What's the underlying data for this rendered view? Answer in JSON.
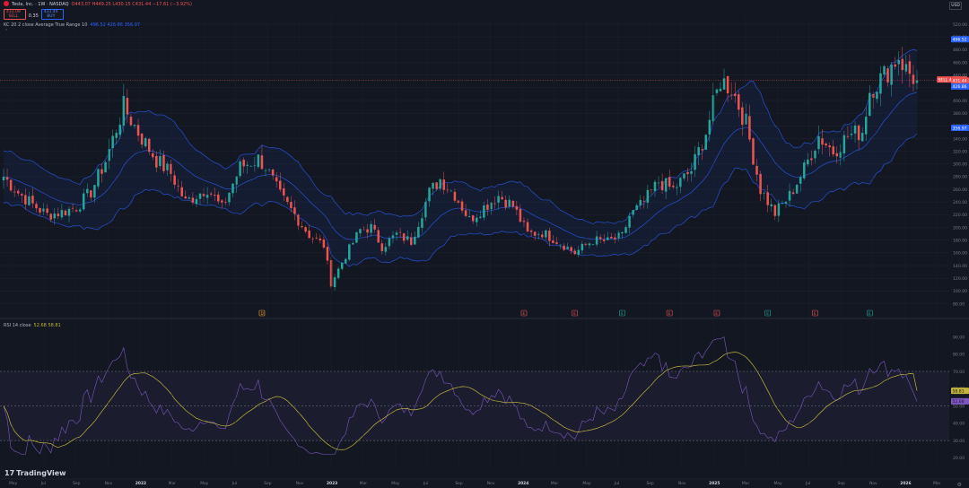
{
  "header": {
    "symbol": "Tesla, Inc. · 1W · NASDAQ",
    "ohlc": "O443.07 H449.25 L430.15 C431.44 −17.61 (−3.92%)",
    "sell_price": "431.09",
    "sell_label": "SELL",
    "spread": "0.35",
    "buy_price": "431.44",
    "buy_label": "BUY",
    "kc_label": "KC 20 2 close Average True Range 10",
    "kc_values": "496.52  426.86  356.97",
    "collapse": "⌃",
    "rsi_label": "RSI 14 close",
    "rsi_values": "52.68  58.81"
  },
  "currency": "USD",
  "brand": "TradingView",
  "settings_icon": "gear-icon",
  "colors": {
    "background": "#131722",
    "up": "#26a69a",
    "down": "#ef5350",
    "band": "#2962ff",
    "rsi": "#7e57c2",
    "rsi_ma": "#c2b43a",
    "grid": "#1e222d",
    "text": "#b2b5be"
  },
  "chart_data": [
    {
      "type": "candlestick",
      "title": "Tesla, Inc. · 1W · NASDAQ",
      "y_ticks": [
        80,
        100,
        120,
        140,
        160,
        180,
        200,
        220,
        240,
        260,
        280,
        300,
        320,
        340,
        360,
        380,
        400,
        420,
        440,
        460,
        480,
        500,
        520
      ],
      "ylim": [
        75,
        530
      ],
      "x_labels": [
        "May",
        "Jul",
        "Sep",
        "Nov",
        "2022",
        "Mar",
        "May",
        "Jul",
        "Sep",
        "Nov",
        "2023",
        "Mar",
        "May",
        "Jul",
        "Sep",
        "Nov",
        "2024",
        "Mar",
        "May",
        "Jul",
        "Sep",
        "Nov",
        "2025",
        "Mar",
        "May",
        "Jul",
        "Sep",
        "Nov",
        "2026",
        "Mar"
      ],
      "weeks": 252,
      "anchors_week": [
        0,
        4,
        8,
        12,
        16,
        20,
        24,
        28,
        33,
        37,
        42,
        46,
        50,
        56,
        60,
        65,
        70,
        72,
        76,
        80,
        84,
        88,
        90,
        94,
        98,
        101,
        104,
        108,
        112,
        117,
        120,
        124,
        128,
        132,
        136,
        140,
        144,
        148,
        153,
        157,
        162,
        166,
        170,
        172,
        176,
        180,
        184,
        189,
        193,
        197,
        200,
        204,
        208,
        212,
        216,
        220,
        224,
        228,
        232,
        236,
        238,
        242,
        246,
        248,
        251
      ],
      "anchors_close": [
        280,
        255,
        236,
        220,
        224,
        232,
        256,
        305,
        390,
        350,
        306,
        285,
        240,
        262,
        230,
        295,
        308,
        296,
        250,
        220,
        188,
        172,
        112,
        156,
        196,
        200,
        170,
        189,
        178,
        255,
        276,
        252,
        212,
        232,
        250,
        234,
        190,
        192,
        176,
        160,
        180,
        178,
        186,
        218,
        240,
        272,
        260,
        290,
        350,
        432,
        420,
        364,
        260,
        222,
        250,
        292,
        344,
        320,
        344,
        352,
        416,
        440,
        470,
        448,
        431
      ],
      "last_close": 431.44,
      "series": [
        {
          "name": "Price",
          "color": "#26a69a"
        },
        {
          "name": "KC upper",
          "color": "#2962ff"
        },
        {
          "name": "KC middle",
          "color": "#2962ff"
        },
        {
          "name": "KC lower",
          "color": "#2962ff"
        }
      ],
      "price_labels": [
        {
          "text": "496.52",
          "value": 496.52,
          "color": "#2962ff"
        },
        {
          "text": "SELL 431.09",
          "value": 433,
          "color": "#ef5350"
        },
        {
          "text": "431.44",
          "value": 431.44,
          "color": "#ef5350"
        },
        {
          "text": "426.86",
          "value": 422,
          "color": "#2962ff"
        },
        {
          "text": "356.97",
          "value": 356.97,
          "color": "#2962ff"
        }
      ],
      "event_markers": [
        {
          "week": 71,
          "label": "D",
          "color": "#f5a623"
        },
        {
          "week": 143,
          "label": "E",
          "color": "#ef5350"
        },
        {
          "week": 157,
          "label": "E",
          "color": "#ef5350"
        },
        {
          "week": 170,
          "label": "E",
          "color": "#26a69a"
        },
        {
          "week": 183,
          "label": "E",
          "color": "#ef5350"
        },
        {
          "week": 196,
          "label": "E",
          "color": "#ef5350"
        },
        {
          "week": 210,
          "label": "E",
          "color": "#26a69a"
        },
        {
          "week": 223,
          "label": "E",
          "color": "#ef5350"
        },
        {
          "week": 238,
          "label": "E",
          "color": "#26a69a"
        }
      ]
    },
    {
      "type": "line",
      "title": "RSI 14 close",
      "y_ticks": [
        20,
        30,
        40,
        50,
        60,
        70,
        80,
        90
      ],
      "ylim": [
        15,
        97
      ],
      "band": [
        30,
        70
      ],
      "series": [
        {
          "name": "RSI",
          "color": "#7e57c2",
          "last": 52.68
        },
        {
          "name": "RSI MA",
          "color": "#c2b43a",
          "last": 58.81
        }
      ],
      "labels": [
        {
          "text": "58.81",
          "value": 58.81,
          "color": "#c2b43a"
        },
        {
          "text": "52.68",
          "value": 52.68,
          "color": "#7e57c2"
        }
      ]
    }
  ]
}
